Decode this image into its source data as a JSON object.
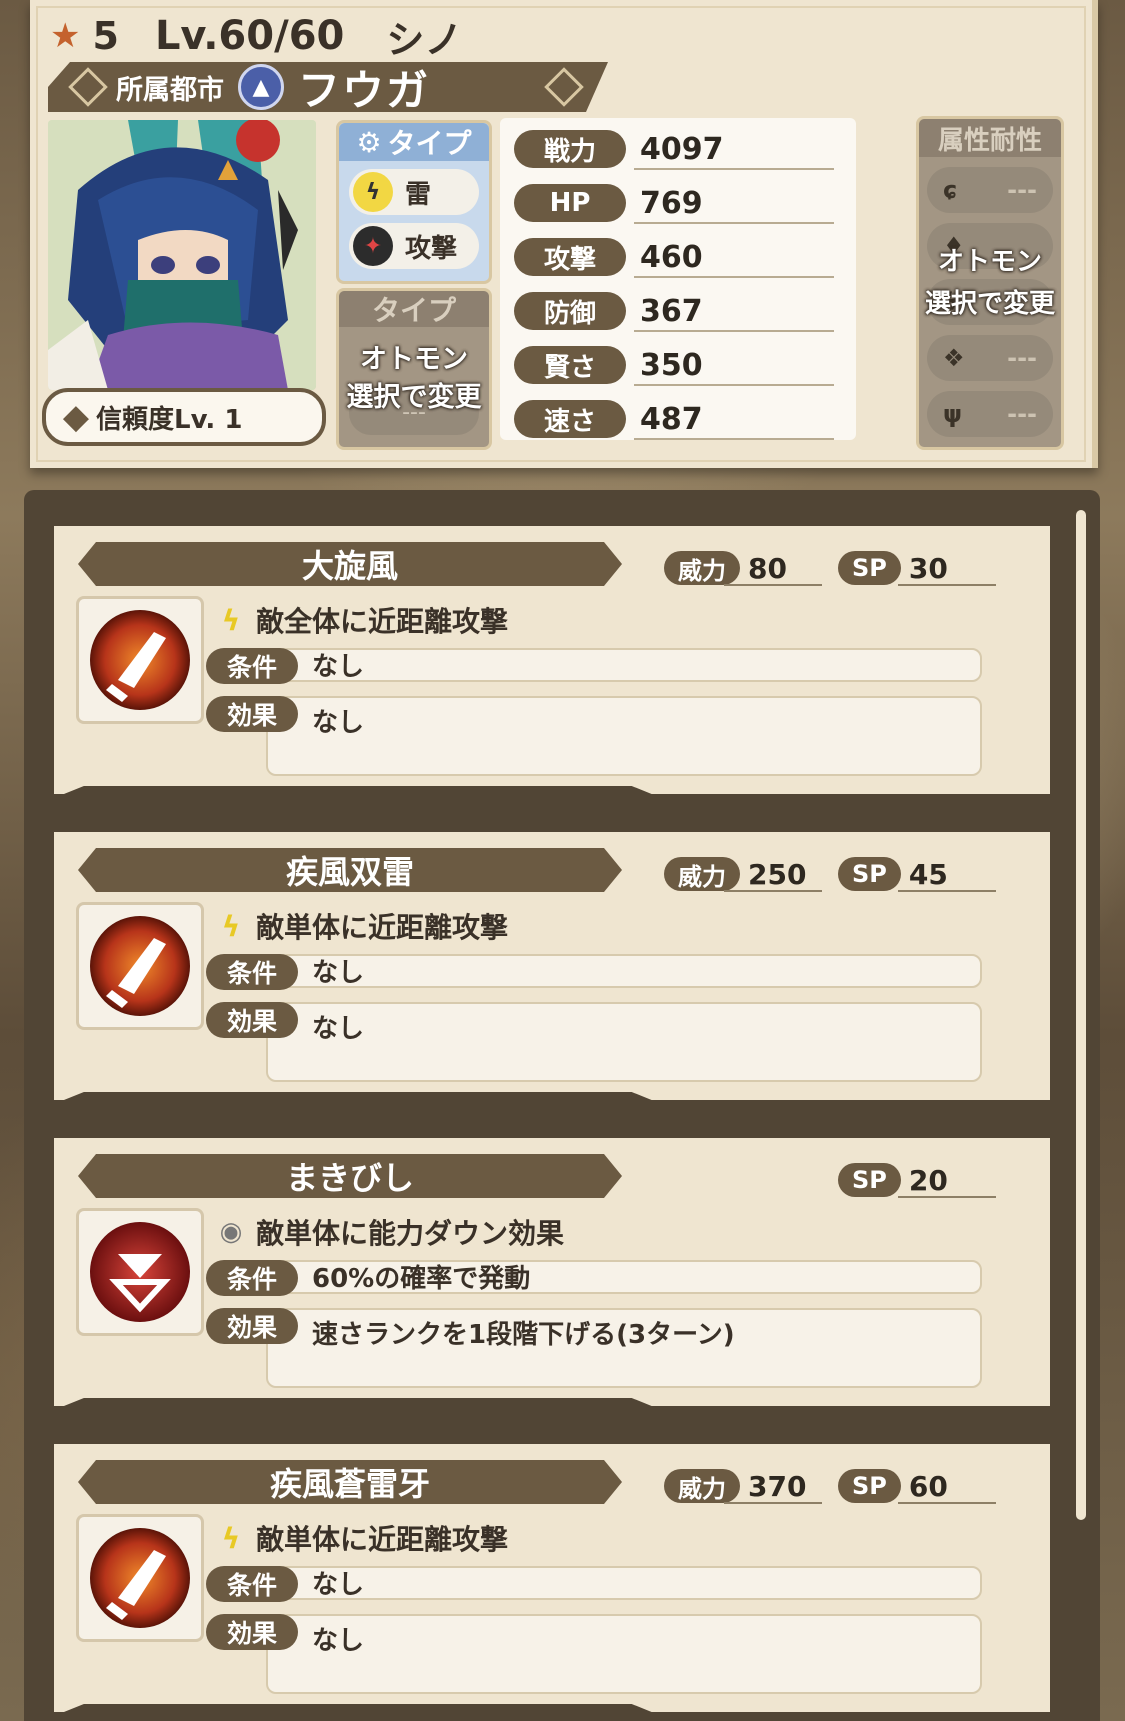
{
  "character": {
    "rarity": "5",
    "level": "Lv.60/60",
    "name": "シノ",
    "city_label": "所属都市",
    "city_name": "フウガ",
    "trust": "信頼度Lv.  1",
    "type_header": "タイプ",
    "type_element": "雷",
    "type_role": "攻撃",
    "type2_header": "タイプ",
    "type2_overlay_1": "オトモン",
    "type2_overlay_2": "選択で変更",
    "type2_value": "---"
  },
  "stats": [
    {
      "label": "戦力",
      "value": "4097"
    },
    {
      "label": "HP",
      "value": "769"
    },
    {
      "label": "攻撃",
      "value": "460"
    },
    {
      "label": "防御",
      "value": "367"
    },
    {
      "label": "賢さ",
      "value": "350"
    },
    {
      "label": "速さ",
      "value": "487"
    }
  ],
  "resistance": {
    "header": "属性耐性",
    "overlay_1": "オトモン",
    "overlay_2": "選択で変更",
    "rows": [
      {
        "icon": "fire-icon",
        "value": "---"
      },
      {
        "icon": "water-icon",
        "value": ""
      },
      {
        "icon": "thunder-icon",
        "value": ""
      },
      {
        "icon": "ice-icon",
        "value": "---"
      },
      {
        "icon": "dragon-icon",
        "value": "---"
      }
    ]
  },
  "skills": [
    {
      "name": "大旋風",
      "power_label": "威力",
      "power": "80",
      "sp_label": "SP",
      "sp": "30",
      "desc": "敵全体に近距離攻撃",
      "cond_label": "条件",
      "cond": "なし",
      "eff_label": "効果",
      "eff": "なし"
    },
    {
      "name": "疾風双雷",
      "power_label": "威力",
      "power": "250",
      "sp_label": "SP",
      "sp": "45",
      "desc": "敵単体に近距離攻撃",
      "cond_label": "条件",
      "cond": "なし",
      "eff_label": "効果",
      "eff": "なし"
    },
    {
      "name": "まきびし",
      "power_label": "",
      "power": "",
      "sp_label": "SP",
      "sp": "20",
      "desc": "敵単体に能力ダウン効果",
      "cond_label": "条件",
      "cond": "60%の確率で発動",
      "eff_label": "効果",
      "eff": "速さランクを1段階下げる(3ターン)"
    },
    {
      "name": "疾風蒼雷牙",
      "power_label": "威力",
      "power": "370",
      "sp_label": "SP",
      "sp": "60",
      "desc": "敵単体に近距離攻撃",
      "cond_label": "条件",
      "cond": "なし",
      "eff_label": "効果",
      "eff": "なし"
    }
  ],
  "colors": {
    "panel": "#efe5d0",
    "label_brown": "#6b5a42",
    "frame": "#514535",
    "thunder": "#f2d743",
    "skill_red": "#c43a1e"
  }
}
